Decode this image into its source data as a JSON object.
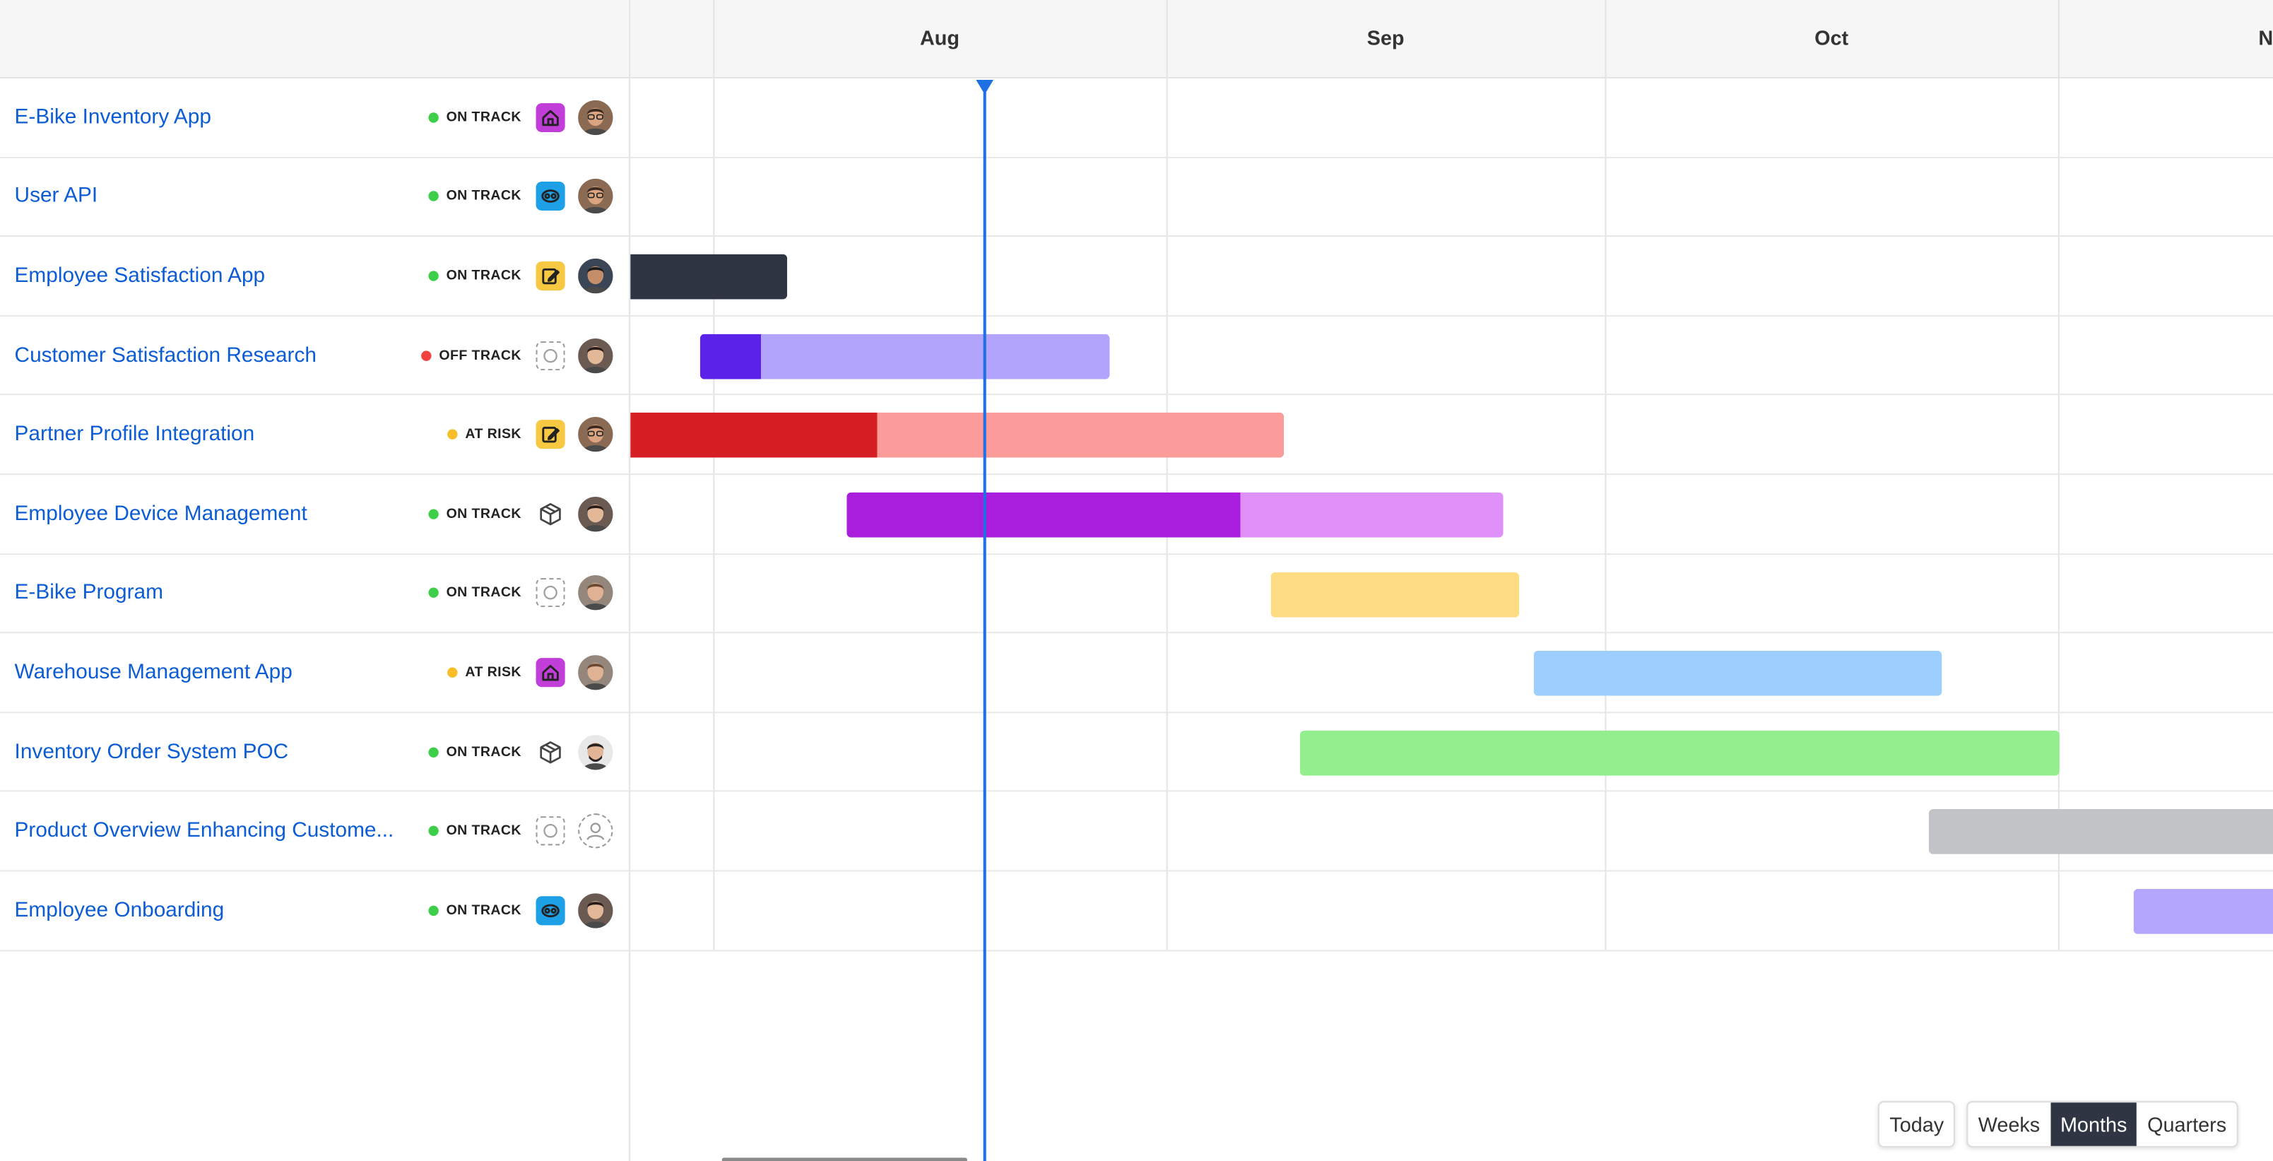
{
  "months": [
    "Aug",
    "Sep",
    "Oct",
    "N"
  ],
  "status_colors": {
    "on_track": "#3ecf4a",
    "off_track": "#f0433f",
    "at_risk": "#f7be2a"
  },
  "projects": [
    {
      "name": "E-Bike Inventory App",
      "status": "ON TRACK",
      "status_key": "on_track",
      "icon": "house-app-icon",
      "icon_bg": "#c23ed8",
      "avatar": "man-glasses-avatar",
      "bar": {
        "start": 0,
        "end": 0,
        "segments": []
      }
    },
    {
      "name": "User API",
      "status": "ON TRACK",
      "status_key": "on_track",
      "icon": "api-cloud-icon",
      "icon_bg": "#1ea0e6",
      "avatar": "man-glasses-avatar",
      "bar": {
        "start": 0,
        "end": 0,
        "segments": []
      }
    },
    {
      "name": "Employee Satisfaction App",
      "status": "ON TRACK",
      "status_key": "on_track",
      "icon": "edit-note-icon",
      "icon_bg": "#f7c841",
      "avatar": "man-dark-avatar",
      "bar": {
        "segments": [
          {
            "color": "#2f3542",
            "pct": 100
          }
        ]
      }
    },
    {
      "name": "Customer Satisfaction Research",
      "status": "OFF TRACK",
      "status_key": "off_track",
      "icon": "empty-circle-icon",
      "icon_bg": "",
      "avatar": "woman-avatar",
      "bar": {
        "segments": [
          {
            "color": "#5b22ea",
            "pct": 15
          },
          {
            "color": "#b2a3fc",
            "pct": 85
          }
        ]
      }
    },
    {
      "name": "Partner Profile Integration",
      "status": "AT RISK",
      "status_key": "at_risk",
      "icon": "edit-note-icon",
      "icon_bg": "#f7c841",
      "avatar": "man-glasses-avatar",
      "bar": {
        "segments": [
          {
            "color": "#d61f24",
            "pct": 37.7
          },
          {
            "color": "#fb9c9a",
            "pct": 62.3
          }
        ]
      }
    },
    {
      "name": "Employee Device Management",
      "status": "ON TRACK",
      "status_key": "on_track",
      "icon": "box-icon",
      "icon_bg": "",
      "avatar": "woman-avatar",
      "bar": {
        "segments": [
          {
            "color": "#a91edc",
            "pct": 60
          },
          {
            "color": "#e090f9",
            "pct": 40
          }
        ]
      }
    },
    {
      "name": "E-Bike Program",
      "status": "ON TRACK",
      "status_key": "on_track",
      "icon": "empty-circle-icon",
      "icon_bg": "",
      "avatar": "man-light-avatar",
      "bar": {
        "segments": [
          {
            "color": "#fddc84",
            "pct": 100
          }
        ]
      }
    },
    {
      "name": "Warehouse Management App",
      "status": "AT RISK",
      "status_key": "at_risk",
      "icon": "house-app-icon",
      "icon_bg": "#c23ed8",
      "avatar": "man-light-avatar",
      "bar": {
        "segments": [
          {
            "color": "#9ccffd",
            "pct": 100
          }
        ]
      }
    },
    {
      "name": "Inventory Order System POC",
      "status": "ON TRACK",
      "status_key": "on_track",
      "icon": "box-icon",
      "icon_bg": "",
      "avatar": "man-beard-avatar",
      "bar": {
        "segments": [
          {
            "color": "#93ef8e",
            "pct": 100
          }
        ]
      }
    },
    {
      "name": "Product Overview Enhancing Custome...",
      "status": "ON TRACK",
      "status_key": "on_track",
      "icon": "empty-circle-icon",
      "icon_bg": "",
      "avatar": "empty-user-icon",
      "bar": {
        "segments": [
          {
            "color": "#c2c3c7",
            "pct": 100
          }
        ]
      }
    },
    {
      "name": "Employee Onboarding",
      "status": "ON TRACK",
      "status_key": "on_track",
      "icon": "api-cloud-icon",
      "icon_bg": "#1ea0e6",
      "avatar": "woman-avatar",
      "bar": {
        "segments": [
          {
            "color": "#b4a6fc",
            "pct": 100
          }
        ]
      }
    }
  ],
  "controls": {
    "today": "Today",
    "weeks": "Weeks",
    "months": "Months",
    "quarters": "Quarters",
    "active": "Months"
  },
  "today_color": "#1f6fe5"
}
